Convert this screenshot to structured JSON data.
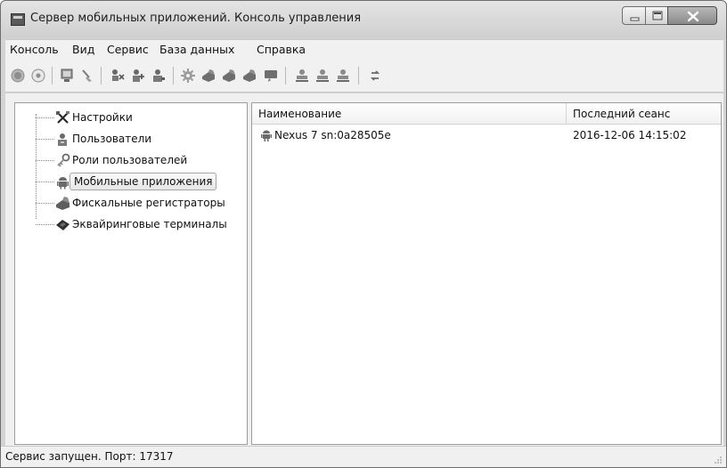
{
  "window": {
    "title": "Сервер мобильных приложений. Консоль управления"
  },
  "menu": [
    {
      "label": "Консоль"
    },
    {
      "label": "Вид"
    },
    {
      "label": "Сервис"
    },
    {
      "label": "База данных"
    },
    {
      "label": "Справка"
    }
  ],
  "toolbar": {
    "groups": [
      [
        "record-icon",
        "stop-icon"
      ],
      [
        "monitor-icon",
        "broom-icon"
      ],
      [
        "users-connect-icon",
        "user-add-icon",
        "user-icon"
      ],
      [
        "gear-icon",
        "fiscal-register-icon",
        "fiscal-register-add-icon",
        "fiscal-register-remove-icon",
        "terminal-icon"
      ],
      [
        "user-green-icon",
        "user-add-green-icon",
        "user-remove-green-icon"
      ],
      [
        "refresh-icon"
      ]
    ]
  },
  "tree": {
    "items": [
      {
        "label": "Настройки",
        "icon": "tools-icon"
      },
      {
        "label": "Пользователи",
        "icon": "user-icon"
      },
      {
        "label": "Роли пользователей",
        "icon": "key-icon"
      },
      {
        "label": "Мобильные приложения",
        "icon": "android-icon",
        "selected": true
      },
      {
        "label": "Фискальные регистраторы",
        "icon": "fiscal-register-icon"
      },
      {
        "label": "Эквайринговые терминалы",
        "icon": "card-terminal-icon"
      }
    ]
  },
  "list": {
    "columns": [
      "Наименование",
      "Последний сеанс"
    ],
    "rows": [
      {
        "name": "Nexus 7 sn:0a28505e",
        "last_session": "2016-12-06 14:15:02",
        "icon": "android-icon"
      }
    ]
  },
  "status": {
    "text": "Сервис запущен. Порт: 17317"
  }
}
